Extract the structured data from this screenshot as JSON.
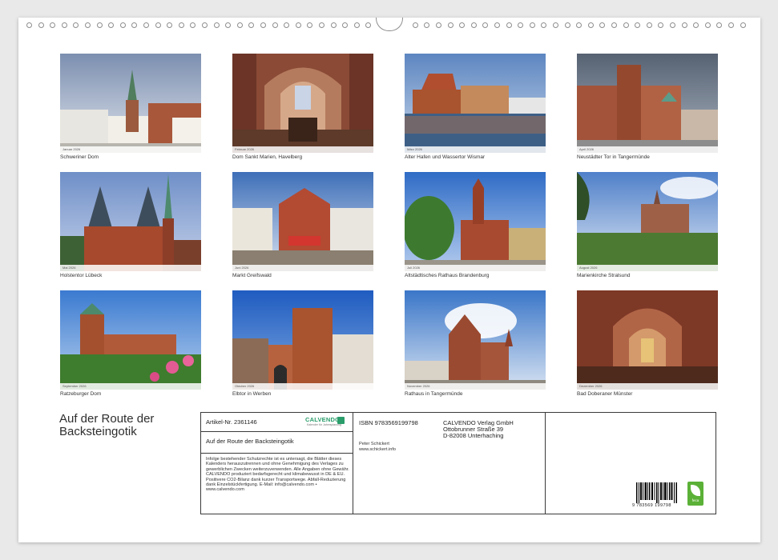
{
  "photos": [
    {
      "caption": "Schweriner Dom",
      "month": "Januar 2026"
    },
    {
      "caption": "Dom Sankt Marien, Havelberg",
      "month": "Februar 2026"
    },
    {
      "caption": "Alter Hafen und Wassertor Wismar",
      "month": "März 2026"
    },
    {
      "caption": "Neustädter Tor in Tangermünde",
      "month": "April 2026"
    },
    {
      "caption": "Holstentor Lübeck",
      "month": "Mai 2026"
    },
    {
      "caption": "Markt Greifswald",
      "month": "Juni 2026"
    },
    {
      "caption": "Altstädtisches Rathaus Brandenburg",
      "month": "Juli 2026"
    },
    {
      "caption": "Marienkirche Stralsund",
      "month": "August 2026"
    },
    {
      "caption": "Ratzeburger Dom",
      "month": "September 2026"
    },
    {
      "caption": "Elbtor in Werben",
      "month": "Oktober 2026"
    },
    {
      "caption": "Rathaus in Tangermünde",
      "month": "November 2026"
    },
    {
      "caption": "Bad Doberaner Münster",
      "month": "Dezember 2026"
    }
  ],
  "title": "Auf der Route der Backsteingotik",
  "info": {
    "article": "Artikel-Nr. 2361146",
    "brand": "CALVENDO",
    "brand_sub": "Kalender für Jahresplanung",
    "subtitle": "Auf der Route der Backsteingotik",
    "legal": "Infolge bestehender Schutzrechte ist es untersagt, die Blätter dieses Kalenders herauszutrennen und ohne Genehmigung des Verlages zu gewerblichen Zwecken weiterzuverwenden. Alle Angaben ohne Gewähr. CALVENDO produziert bedarfsgerecht und klimabewusst in DE & EU. Positivere CO2-Bilanz dank kurzer Transportwege. Abfall-Reduzierung dank Einzelstückfertigung. E-Mail: info@calvendo.com • www.calvendo.com",
    "isbn": "ISBN 9783569199798",
    "publisher_name": "CALVENDO Verlag GmbH",
    "publisher_street": "Ottobrunner Straße 39",
    "publisher_city": "D-82008 Unterhaching",
    "author": "Peter Schickert",
    "author_web": "www.schickert.info",
    "barcode_number": "9 783569 199798",
    "eco_label": "feca"
  },
  "colors": {
    "brand": "#2a9d6b",
    "eco": "#5bb137"
  }
}
